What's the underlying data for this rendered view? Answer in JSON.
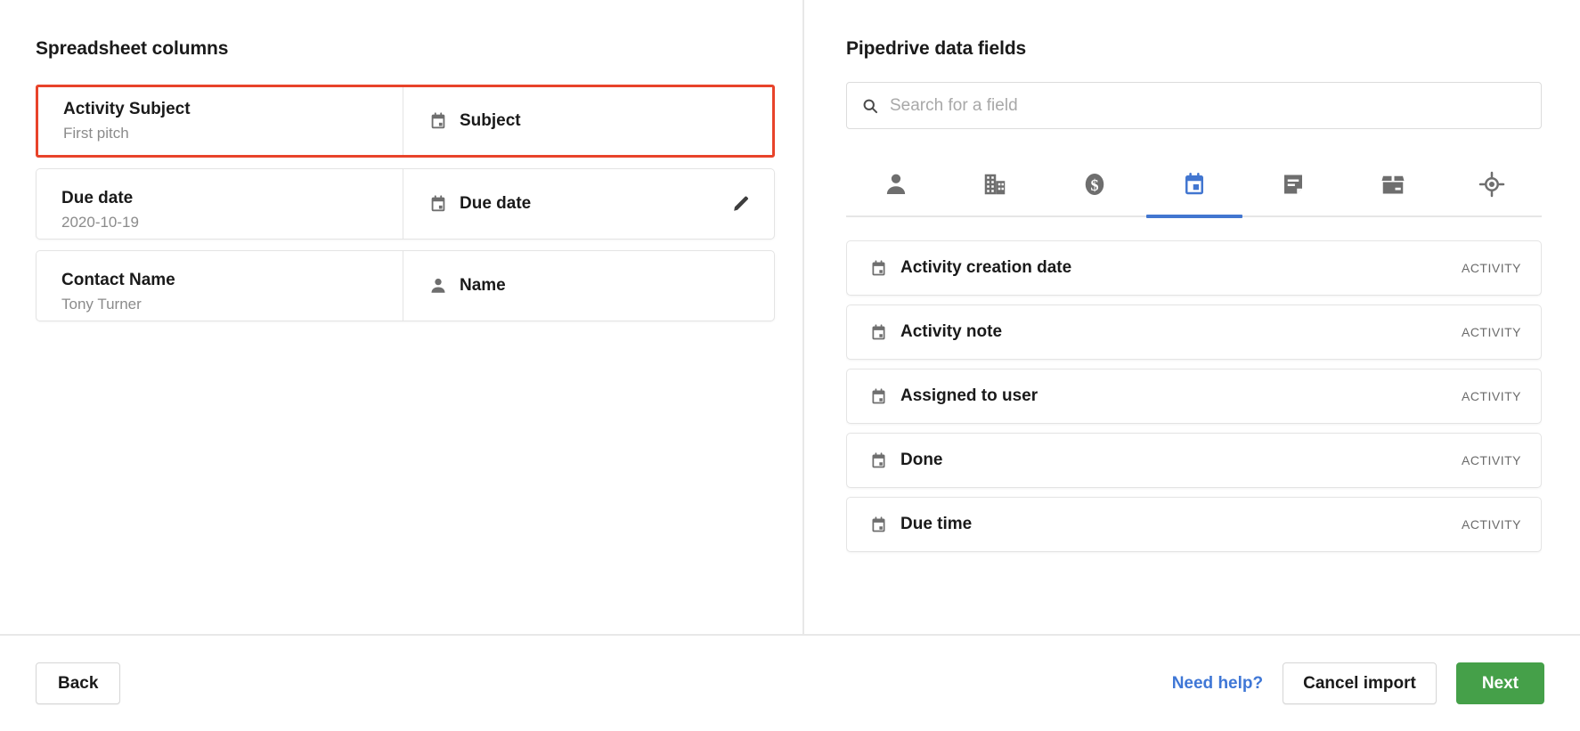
{
  "left": {
    "title": "Spreadsheet columns",
    "rows": [
      {
        "column_name": "Activity Subject",
        "sample_value": "First pitch",
        "mapped_field": "Subject",
        "mapped_icon": "calendar-icon",
        "selected": true,
        "editable": false
      },
      {
        "column_name": "Due date",
        "sample_value": "2020-10-19",
        "mapped_field": "Due date",
        "mapped_icon": "calendar-icon",
        "selected": false,
        "editable": true
      },
      {
        "column_name": "Contact Name",
        "sample_value": "Tony Turner",
        "mapped_field": "Name",
        "mapped_icon": "person-icon",
        "selected": false,
        "editable": false
      }
    ]
  },
  "right": {
    "title": "Pipedrive data fields",
    "search": {
      "placeholder": "Search for a field",
      "value": "",
      "icon": "search-icon"
    },
    "tabs": [
      {
        "icon": "person-icon",
        "name": "person",
        "active": false
      },
      {
        "icon": "organization-icon",
        "name": "organization",
        "active": false
      },
      {
        "icon": "deal-dollar-icon",
        "name": "deal",
        "active": false
      },
      {
        "icon": "calendar-icon",
        "name": "activity",
        "active": true
      },
      {
        "icon": "note-icon",
        "name": "note",
        "active": false
      },
      {
        "icon": "product-box-icon",
        "name": "product",
        "active": false
      },
      {
        "icon": "lead-target-icon",
        "name": "lead",
        "active": false
      }
    ],
    "fields": [
      {
        "label": "Activity creation date",
        "tag": "ACTIVITY",
        "icon": "calendar-icon"
      },
      {
        "label": "Activity note",
        "tag": "ACTIVITY",
        "icon": "calendar-icon"
      },
      {
        "label": "Assigned to user",
        "tag": "ACTIVITY",
        "icon": "calendar-icon"
      },
      {
        "label": "Done",
        "tag": "ACTIVITY",
        "icon": "calendar-icon"
      },
      {
        "label": "Due time",
        "tag": "ACTIVITY",
        "icon": "calendar-icon"
      }
    ]
  },
  "footer": {
    "back_label": "Back",
    "help_label": "Need help?",
    "cancel_label": "Cancel import",
    "next_label": "Next"
  },
  "colors": {
    "selection_red": "#e8432a",
    "active_blue": "#4276d0",
    "primary_green": "#45a049",
    "link_blue": "#3f77d6",
    "icon_gray": "#6e6e6e"
  }
}
